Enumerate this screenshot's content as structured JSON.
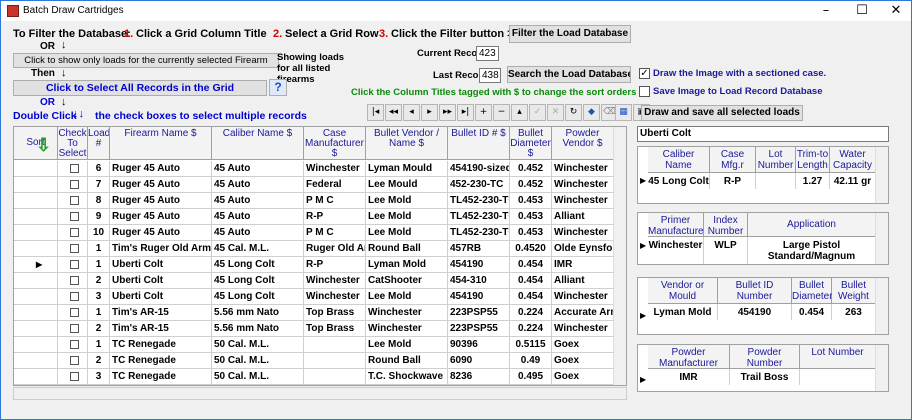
{
  "window": {
    "title": "Batch Draw Cartridges",
    "min": "–",
    "max": "☐",
    "close": "✕"
  },
  "filter_help": {
    "intro": "To Filter the Database:",
    "step1_num": "1.",
    "step1": "Click a Grid Column Title",
    "step2_num": "2.",
    "step2": "Select a Grid Row",
    "step3_num": "3.",
    "step3": "Click the Filter button >>",
    "or1": "OR",
    "then": "Then",
    "or2": "OR",
    "double_click_prefix": "Double Click",
    "double_click_suffix": "the check boxes to select multiple records"
  },
  "buttons": {
    "filter": "Filter the Load Database",
    "firearm_only": "Click to show only loads for the currently selected Firearm",
    "select_all": "Click to Select All Records in the Grid",
    "search": "Search the Load Database",
    "draw_save": "Draw and save all selected loads",
    "help": "?"
  },
  "showing": "Showing loads for all listed firearms",
  "current_record_label": "Current Record #",
  "current_record": "423",
  "last_record_label": "Last Record #",
  "last_record": "438",
  "sort_hint": "Click the Column Titles tagged with $ to change the sort orders",
  "options": {
    "draw_sectioned": "Draw the Image with a sectioned case.",
    "draw_sectioned_checked": true,
    "save_image": "Save Image to Load Record  Database",
    "save_image_checked": false
  },
  "firearm_name": "Uberti Colt",
  "grid": {
    "headers": [
      "Sort",
      "Check To Select",
      "Load #",
      "Firearm Name $",
      "Caliber Name $",
      "Case Manufacturer $",
      "Bullet Vendor / Name $",
      "Bullet ID # $",
      "Bullet Diameter $",
      "Powder Vendor $"
    ],
    "rows": [
      {
        "load": "6",
        "firearm": "Ruger 45 Auto",
        "caliber": "45 Auto",
        "case_mfr": "Winchester",
        "bullet": "Lyman Mould",
        "bullet_id": "454190-sized",
        "diameter": "0.452",
        "powder": "Winchester"
      },
      {
        "load": "7",
        "firearm": "Ruger 45 Auto",
        "caliber": "45 Auto",
        "case_mfr": "Federal",
        "bullet": "Lee Mould",
        "bullet_id": "452-230-TC",
        "diameter": "0.452",
        "powder": "Winchester"
      },
      {
        "load": "8",
        "firearm": "Ruger 45 Auto",
        "caliber": "45 Auto",
        "case_mfr": "P M C",
        "bullet": "Lee Mold",
        "bullet_id": "TL452-230-TC",
        "diameter": "0.453",
        "powder": "Winchester"
      },
      {
        "load": "9",
        "firearm": "Ruger 45 Auto",
        "caliber": "45 Auto",
        "case_mfr": "R-P",
        "bullet": "Lee Mold",
        "bullet_id": "TL452-230-TC",
        "diameter": "0.453",
        "powder": "Alliant"
      },
      {
        "load": "10",
        "firearm": "Ruger 45 Auto",
        "caliber": "45 Auto",
        "case_mfr": "P M C",
        "bullet": "Lee Mold",
        "bullet_id": "TL452-230-TC",
        "diameter": "0.453",
        "powder": "Winchester"
      },
      {
        "load": "1",
        "firearm": "Tim's Ruger Old Army",
        "caliber": "45 Cal. M.L.",
        "case_mfr": "Ruger Old Army",
        "bullet": "Round Ball",
        "bullet_id": "457RB",
        "diameter": "0.4520",
        "powder": "Olde Eynsford"
      },
      {
        "load": "1",
        "firearm": "Uberti Colt",
        "caliber": "45 Long Colt",
        "case_mfr": "R-P",
        "bullet": "Lyman Mold",
        "bullet_id": "454190",
        "diameter": "0.454",
        "powder": "IMR",
        "current": true
      },
      {
        "load": "2",
        "firearm": "Uberti Colt",
        "caliber": "45 Long Colt",
        "case_mfr": "Winchester",
        "bullet": "CatShooter",
        "bullet_id": "454-310",
        "diameter": "0.454",
        "powder": "Alliant"
      },
      {
        "load": "3",
        "firearm": "Uberti Colt",
        "caliber": "45 Long Colt",
        "case_mfr": "Winchester",
        "bullet": "Lee Mold",
        "bullet_id": "454190",
        "diameter": "0.454",
        "powder": "Winchester"
      },
      {
        "load": "1",
        "firearm": "Tim's AR-15",
        "caliber": "5.56 mm Nato",
        "case_mfr": "Top Brass",
        "bullet": "Winchester",
        "bullet_id": "223PSP55",
        "diameter": "0.224",
        "powder": "Accurate Arms"
      },
      {
        "load": "2",
        "firearm": "Tim's AR-15",
        "caliber": "5.56 mm Nato",
        "case_mfr": "Top Brass",
        "bullet": "Winchester",
        "bullet_id": "223PSP55",
        "diameter": "0.224",
        "powder": "Winchester"
      },
      {
        "load": "1",
        "firearm": "TC Renegade",
        "caliber": "50 Cal.  M.L.",
        "case_mfr": "",
        "bullet": "Lee Mold",
        "bullet_id": "90396",
        "diameter": "0.5115",
        "powder": "Goex"
      },
      {
        "load": "2",
        "firearm": "TC Renegade",
        "caliber": "50 Cal.  M.L.",
        "case_mfr": "",
        "bullet": "Round Ball",
        "bullet_id": "6090",
        "diameter": "0.49",
        "powder": "Goex"
      },
      {
        "load": "3",
        "firearm": "TC Renegade",
        "caliber": "50 Cal.  M.L.",
        "case_mfr": "",
        "bullet": "T.C. Shockwave",
        "bullet_id": "8236",
        "diameter": "0.495",
        "powder": "Goex"
      }
    ]
  },
  "case_panel": {
    "headers": [
      "Caliber Name",
      "Case Mfg.r",
      "Lot Number",
      "Trim-to Length",
      "Water Capacity"
    ],
    "values": [
      "45 Long Colt",
      "R-P",
      "",
      "1.27",
      "42.11 gr"
    ]
  },
  "primer_panel": {
    "headers": [
      "Primer Manufacturer",
      "Index Number",
      "Application"
    ],
    "values": [
      "Winchester",
      "WLP",
      "Large Pistol Standard/Magnum"
    ]
  },
  "bullet_panel": {
    "headers": [
      "Vendor or Mould",
      "Bullet ID Number",
      "Bullet Diameter",
      "Bullet Weight"
    ],
    "values": [
      "Lyman Mold",
      "454190",
      "0.454",
      "263"
    ]
  },
  "powder_panel": {
    "headers": [
      "Powder Manufacturer",
      "Powder Number",
      "Lot Number"
    ],
    "values": [
      "IMR",
      "Trail Boss",
      ""
    ]
  }
}
